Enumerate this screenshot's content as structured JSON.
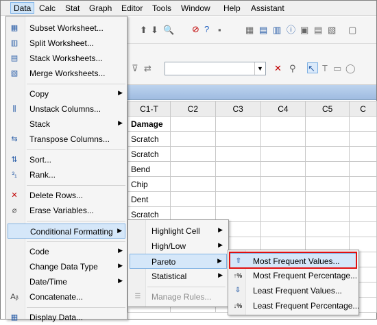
{
  "menubar": {
    "items": [
      "Data",
      "Calc",
      "Stat",
      "Graph",
      "Editor",
      "Tools",
      "Window",
      "Help",
      "Assistant"
    ],
    "active": "Data"
  },
  "worksheet": {
    "columns": [
      "C1-T",
      "C2",
      "C3",
      "C4",
      "C5",
      "C"
    ],
    "column_names": [
      "Damage",
      "",
      "",
      "",
      "",
      ""
    ],
    "c1_values": [
      "Scratch",
      "Scratch",
      "Bend",
      "Chip",
      "Dent",
      "Scratch"
    ]
  },
  "data_menu": {
    "items": [
      {
        "label": "Subset Worksheet...",
        "icon": "subset-worksheet-icon"
      },
      {
        "label": "Split Worksheet...",
        "icon": "split-worksheet-icon"
      },
      {
        "label": "Stack Worksheets...",
        "icon": "stack-worksheets-icon"
      },
      {
        "label": "Merge Worksheets...",
        "icon": "merge-worksheets-icon"
      },
      {
        "label": "Copy",
        "has_submenu": true
      },
      {
        "label": "Unstack Columns...",
        "icon": "unstack-columns-icon"
      },
      {
        "label": "Stack",
        "has_submenu": true
      },
      {
        "label": "Transpose Columns...",
        "icon": "transpose-columns-icon"
      },
      {
        "label": "Sort...",
        "icon": "sort-icon"
      },
      {
        "label": "Rank...",
        "icon": "rank-icon"
      },
      {
        "label": "Delete Rows...",
        "icon": "delete-rows-icon"
      },
      {
        "label": "Erase Variables...",
        "icon": "erase-variables-icon"
      },
      {
        "label": "Conditional Formatting",
        "has_submenu": true,
        "highlighted": true
      },
      {
        "label": "Code",
        "has_submenu": true
      },
      {
        "label": "Change Data Type",
        "has_submenu": true
      },
      {
        "label": "Date/Time",
        "has_submenu": true
      },
      {
        "label": "Concatenate...",
        "icon": "concatenate-icon"
      },
      {
        "label": "Display Data...",
        "icon": "display-data-icon"
      }
    ]
  },
  "conditional_formatting_menu": {
    "items": [
      {
        "label": "Highlight Cell",
        "has_submenu": true
      },
      {
        "label": "High/Low",
        "has_submenu": true
      },
      {
        "label": "Pareto",
        "has_submenu": true,
        "highlighted": true
      },
      {
        "label": "Statistical",
        "has_submenu": true
      },
      {
        "label": "Manage Rules...",
        "disabled": true
      }
    ]
  },
  "pareto_menu": {
    "items": [
      {
        "label": "Most Frequent Values...",
        "icon": "up-arrow-icon",
        "icon_text": "⇧",
        "selected": true
      },
      {
        "label": "Most Frequent Percentage...",
        "icon": "up-percent-icon",
        "icon_text": "↑%"
      },
      {
        "label": "Least Frequent Values...",
        "icon": "down-arrow-icon",
        "icon_text": "⇩"
      },
      {
        "label": "Least Frequent Percentage...",
        "icon": "down-percent-icon",
        "icon_text": "↓%"
      }
    ]
  },
  "colors": {
    "highlight": "#d5e7f9",
    "selection_box": "#e01010",
    "title_bar": "#9fbbe0"
  }
}
